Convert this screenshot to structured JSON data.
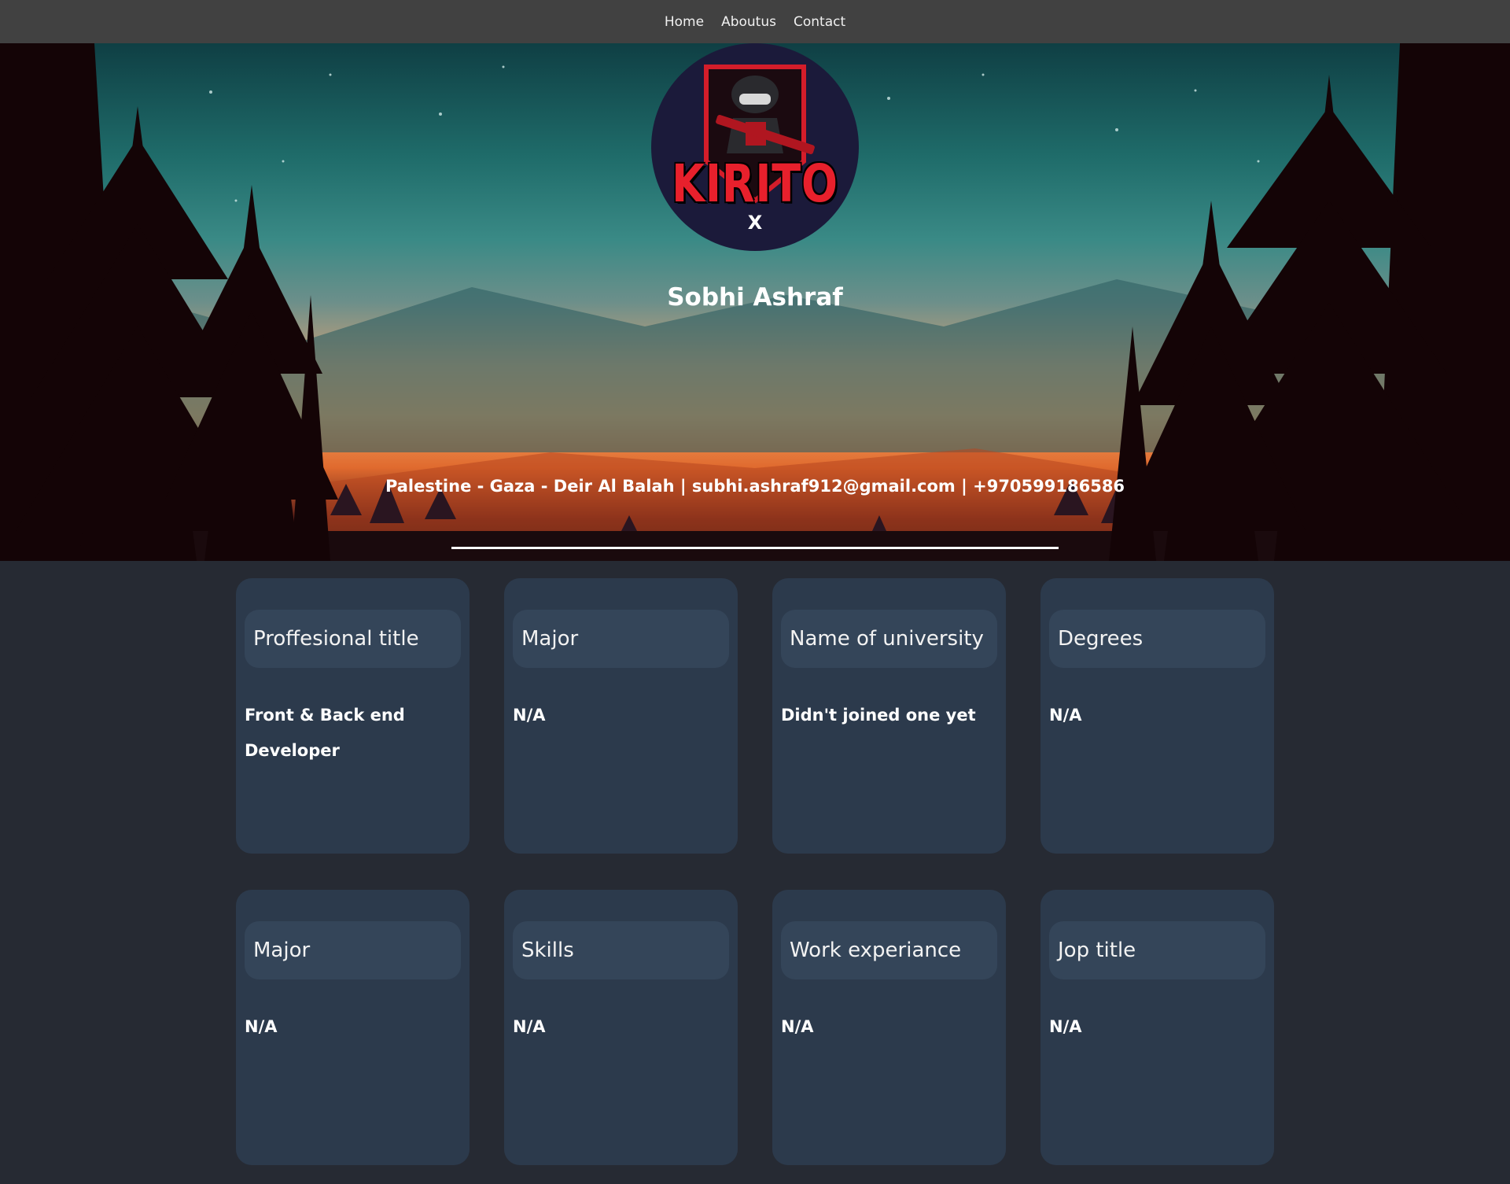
{
  "nav": {
    "links": [
      "Home",
      "Aboutus",
      "Contact"
    ]
  },
  "hero": {
    "logo_text": "KIRITO",
    "logo_mark": "X",
    "name": "Sobhi Ashraf",
    "contact_line": "Palestine - Gaza - Deir Al Balah | subhi.ashraf912@gmail.com | +970599186586"
  },
  "cards": [
    {
      "label": "Proffesional title",
      "value": "Front & Back end Developer"
    },
    {
      "label": "Major",
      "value": "N/A"
    },
    {
      "label": "Name of university",
      "value": "Didn't joined one yet"
    },
    {
      "label": "Degrees",
      "value": "N/A"
    },
    {
      "label": "Major",
      "value": "N/A"
    },
    {
      "label": "Skills",
      "value": "N/A"
    },
    {
      "label": "Work experiance",
      "value": "N/A"
    },
    {
      "label": "Jop title",
      "value": "N/A"
    }
  ],
  "colors": {
    "nav_bg": "#414141",
    "page_bg": "#262a33",
    "card_bg": "#2c3a4c",
    "label_bg": "#344559",
    "logo_red": "#e8202c"
  }
}
